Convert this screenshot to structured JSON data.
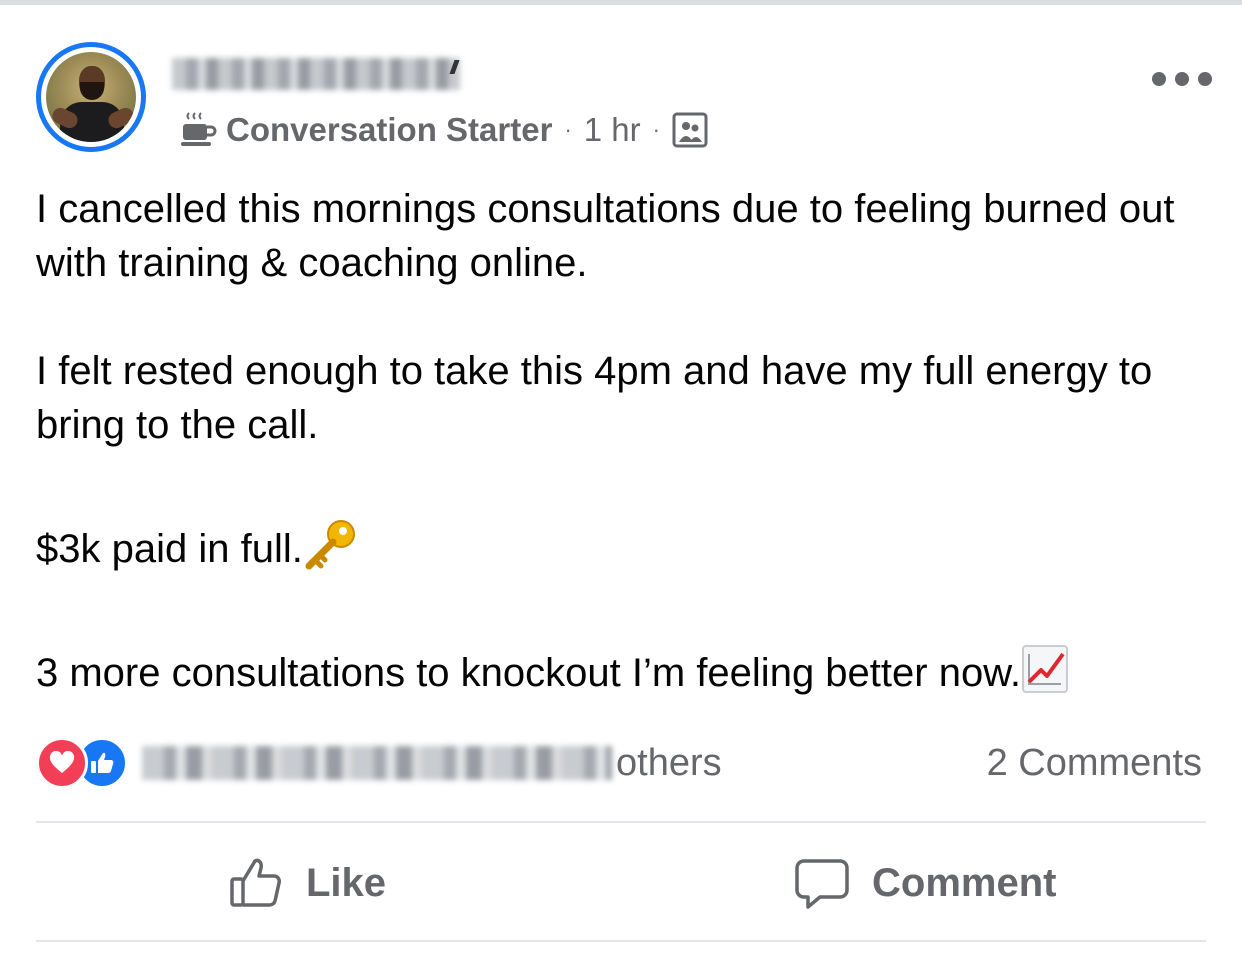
{
  "post": {
    "author": {
      "name": "",
      "name_redacted": true
    },
    "badge": {
      "icon": "coffee-cup-icon",
      "label": "Conversation Starter"
    },
    "time": "1 hr",
    "separator": "·",
    "audience_icon": "group-members-icon",
    "more_icon": "more-options-icon",
    "paragraphs": [
      "I cancelled this mornings consultations due to feeling burned out with training & coaching online.",
      "I felt rested enough to take this 4pm and have my full energy to bring to the call.",
      "$3k paid in full.",
      "3 more consultations to knockout I’m feeling better now."
    ],
    "emojis": {
      "paragraph_3": "key",
      "paragraph_4": "chart-increasing"
    }
  },
  "reactions": {
    "types": [
      "love",
      "like"
    ],
    "summary_suffix": "others",
    "comments": "2 Comments"
  },
  "actions": {
    "like_label": "Like",
    "comment_label": "Comment"
  },
  "colors": {
    "accent": "#1877f2",
    "love": "#f33e58",
    "secondary_text": "#65676b",
    "divider": "#e4e6eb"
  }
}
